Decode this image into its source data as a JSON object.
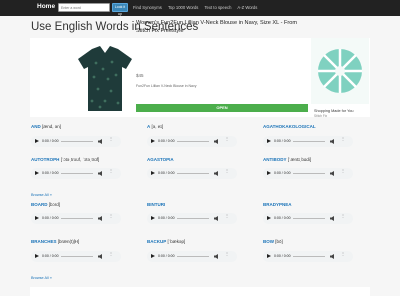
{
  "nav": {
    "brand": "Home",
    "search_placeholder": "Enter a word",
    "lookup": "Look it up",
    "links": [
      "Find Synonyms",
      "Top 1000 Words",
      "Text to speech",
      "A-Z Words"
    ]
  },
  "page_title": "Use English Words in Sentences",
  "ad": {
    "title": "Women's Fun2Fun Lillian V-Neck Blouse in Navy, Size XL - From Stitch Fix Freestyle",
    "price": "$45",
    "subtitle": "Fun2Fun Lillian V-Neck Blouse in Navy",
    "open_button": "OPEN",
    "side_title": "Shopping Made for You",
    "side_sub": "Stitch Fix"
  },
  "player_time": "0:00 / 0:00",
  "browse_label": "Browse All »",
  "words": [
    {
      "word": "AND",
      "pron": "[ænd, ən]"
    },
    {
      "word": "A",
      "pron": "[ə, eɪ]"
    },
    {
      "word": "AGATHOKAKOLOGICAL",
      "pron": ""
    },
    {
      "word": "AUTOTROPH",
      "pron": "[ˈɔtəˌtroʊf, ˈɔtəˌtrɑf]"
    },
    {
      "word": "AGASTOPIA",
      "pron": ""
    },
    {
      "word": "ANTIBODY",
      "pron": "[ˈæntɪˌbɑdi]"
    },
    {
      "word": "BOARD",
      "pron": "[bɔrd]"
    },
    {
      "word": "BINTURI",
      "pron": ""
    },
    {
      "word": "BRADYPNEA",
      "pron": ""
    },
    {
      "word": "BRANCHES",
      "pron": "[bræn(t)ʃH]"
    },
    {
      "word": "BACKUP",
      "pron": "[ˈbækəp]"
    },
    {
      "word": "BOW",
      "pron": "[bō]"
    }
  ]
}
